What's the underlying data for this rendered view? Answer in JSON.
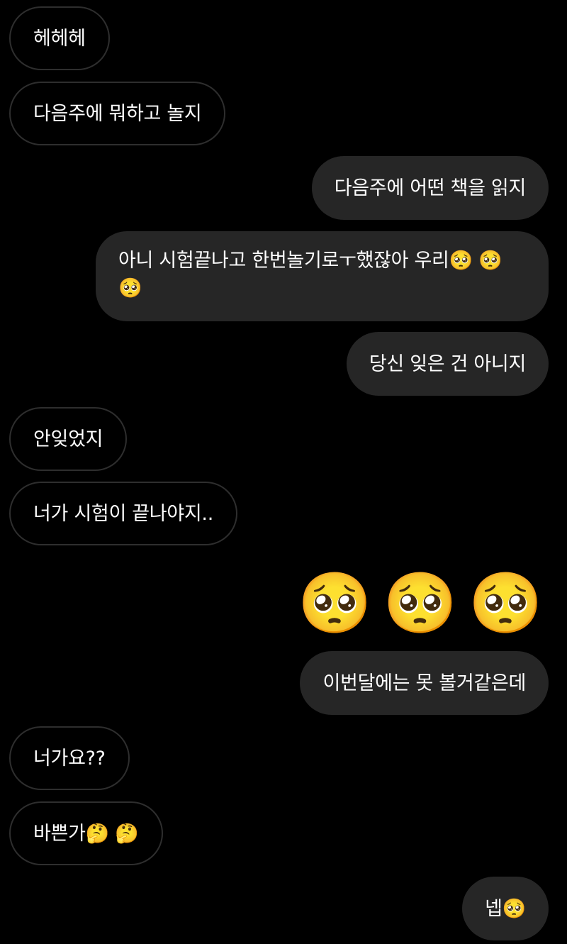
{
  "messages": [
    {
      "side": "in",
      "text": "헤헤헤"
    },
    {
      "side": "in",
      "text": "다음주에 뭐하고 놀지"
    },
    {
      "side": "out",
      "text": "다음주에 어떤 책을 읽지"
    },
    {
      "side": "out",
      "text": "아니 시험끝나고 한번놀기로ㅜ했잖아 우리🥺 🥺 🥺"
    },
    {
      "side": "out",
      "text": "당신 잊은 건 아니지"
    },
    {
      "side": "in",
      "text": "안잊었지"
    },
    {
      "side": "in",
      "text": "너가 시험이 끝나야지.."
    },
    {
      "side": "out",
      "text": "🥺🥺🥺"
    },
    {
      "side": "out",
      "text": "이번달에는 못 볼거같은데"
    },
    {
      "side": "in",
      "text": "너가요??"
    },
    {
      "side": "in",
      "text": "바쁜가🤔 🤔"
    },
    {
      "side": "out",
      "text": "넵🥺"
    }
  ],
  "big_emojis": [
    "🥺",
    "🥺",
    "🥺"
  ],
  "colors": {
    "background": "#000000",
    "incoming_border": "#2e2e2e",
    "outgoing_fill": "#262626",
    "text": "#ffffff"
  }
}
